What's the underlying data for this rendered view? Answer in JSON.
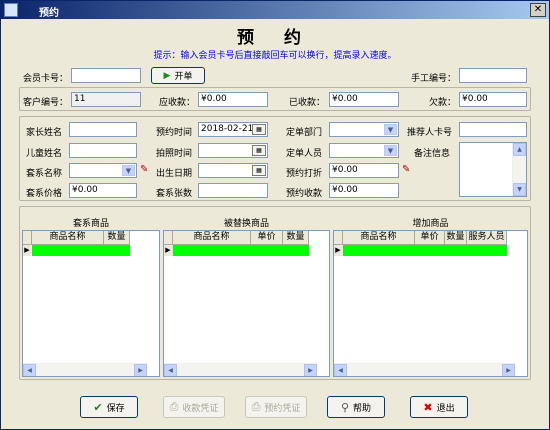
{
  "window": {
    "title": "预约",
    "close_glyph": "✕"
  },
  "heading": "预  约",
  "hint": "提示：输入会员卡号后直接敲回车可以换行，提高录入速度。",
  "row1": {
    "card_label": "会员卡号：",
    "open_button": "开单",
    "staff_no_label": "手工编号："
  },
  "row2": {
    "customer_no_label": "客户编号：",
    "customer_no_value": "11",
    "receivable_label": "应收款：",
    "receivable_value": "¥0.00",
    "received_label": "已收款：",
    "received_value": "¥0.00",
    "owed_label": "欠款：",
    "owed_value": "¥0.00"
  },
  "form": {
    "parent_name_label": "家长姓名",
    "appt_time_label": "预约时间",
    "appt_time_value": "2018-02-21",
    "dept_label": "定单部门",
    "referrer_card_label": "推荐人卡号",
    "child_name_label": "儿童姓名",
    "photo_time_label": "拍照时间",
    "staff_label": "定单人员",
    "notes_label": "备注信息",
    "package_name_label": "套系名称",
    "birth_date_label": "出生日期",
    "discount_label": "预约打折",
    "discount_value": "¥0.00",
    "package_price_label": "套系价格",
    "package_price_value": "¥0.00",
    "sheets_label": "套系张数",
    "appt_received_label": "预约收款",
    "appt_received_value": "¥0.00"
  },
  "grids": {
    "package": {
      "title": "套系商品",
      "columns": [
        "商品名称",
        "数量"
      ]
    },
    "replaced": {
      "title": "被替换商品",
      "columns": [
        "商品名称",
        "单价",
        "数量"
      ]
    },
    "added": {
      "title": "增加商品",
      "columns": [
        "商品名称",
        "单价",
        "数量",
        "服务人员"
      ]
    }
  },
  "buttons": {
    "save": "保存",
    "receipt": "收款凭证",
    "appt_receipt": "预约凭证",
    "help": "帮助",
    "exit": "退出"
  },
  "colors": {
    "selected_row": "#00ff00",
    "hint": "#0000ff",
    "title_start": "#0a246a"
  }
}
